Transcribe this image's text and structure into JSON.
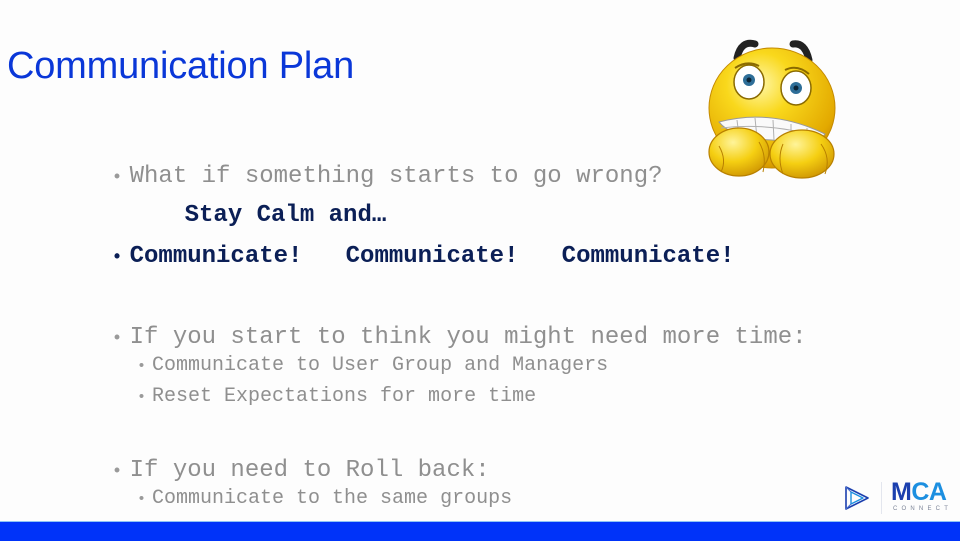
{
  "slide": {
    "title": "Communication Plan",
    "bullets": [
      {
        "bullet": "•",
        "text": "What if something starts to go wrong?"
      },
      {
        "text": "Stay Calm and…"
      },
      {
        "bullet": "•",
        "text": "Communicate!   Communicate!   Communicate!"
      },
      {
        "bullet": "•",
        "text": "If you start to think you might need more time:"
      },
      {
        "bullet": "•",
        "text": "Communicate to User Group and Managers"
      },
      {
        "bullet": "•",
        "text": "Reset Expectations for more time"
      },
      {
        "bullet": "•",
        "text": "If you need to Roll back:"
      },
      {
        "bullet": "•",
        "text": "Communicate to the same groups"
      }
    ]
  },
  "image": {
    "icon": "worried-smiley-emoji-icon"
  },
  "logo": {
    "letters_dark": "M",
    "letters_light": "CA",
    "subtitle": "CONNECT",
    "icon": "play-triangle-logo-icon"
  },
  "colors": {
    "title": "#0a37d8",
    "body_gray": "#8f8f8f",
    "emphasis_navy": "#0b1f56",
    "footer_bar": "#0033f9",
    "logo_dark": "#1b3fae",
    "logo_light": "#1c8fe0"
  }
}
